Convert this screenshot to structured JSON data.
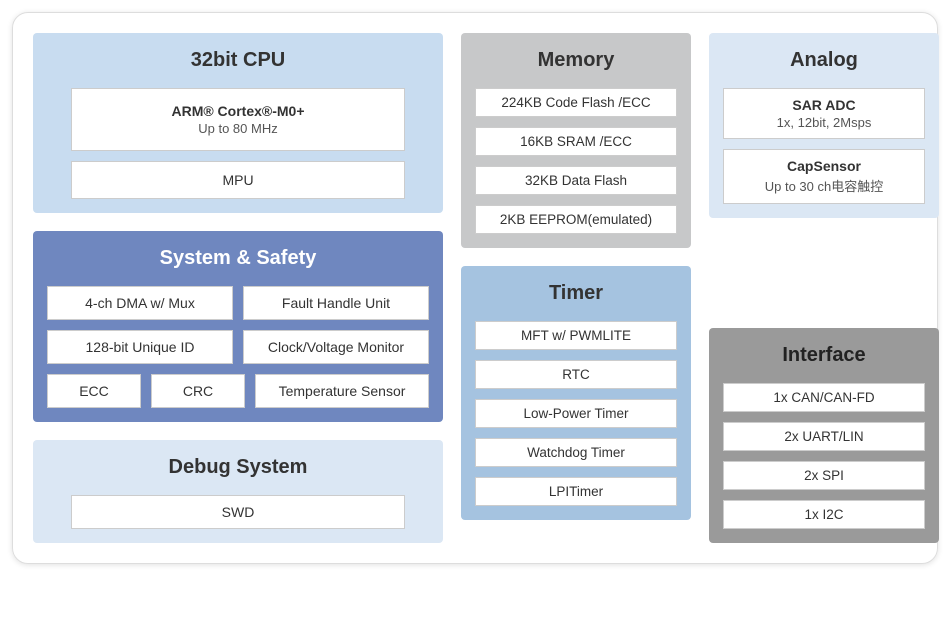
{
  "cpu": {
    "title": "32bit CPU",
    "core_name": "ARM® Cortex®-M0+",
    "core_freq": "Up to 80 MHz",
    "mpu": "MPU"
  },
  "memory": {
    "title": "Memory",
    "items": [
      "224KB Code Flash /ECC",
      "16KB SRAM /ECC",
      "32KB Data Flash",
      "2KB EEPROM(emulated)"
    ]
  },
  "analog": {
    "title": "Analog",
    "sar_name": "SAR ADC",
    "sar_detail": "1x, 12bit, 2Msps",
    "cap_name": "CapSensor",
    "cap_detail": "Up to 30 ch电容触控"
  },
  "safety": {
    "title": "System & Safety",
    "row1": [
      "4-ch DMA w/ Mux",
      "Fault Handle Unit"
    ],
    "row2": [
      "128-bit Unique ID",
      "Clock/Voltage Monitor"
    ],
    "row3": [
      "ECC",
      "CRC",
      "Temperature Sensor"
    ]
  },
  "timer": {
    "title": "Timer",
    "items": [
      "MFT w/ PWMLITE",
      "RTC",
      "Low-Power Timer",
      "Watchdog Timer",
      "LPITimer"
    ]
  },
  "interface": {
    "title": "Interface",
    "items": [
      "1x CAN/CAN-FD",
      "2x UART/LIN",
      "2x SPI",
      "1x I2C"
    ]
  },
  "debug": {
    "title": "Debug System",
    "swd": "SWD"
  }
}
